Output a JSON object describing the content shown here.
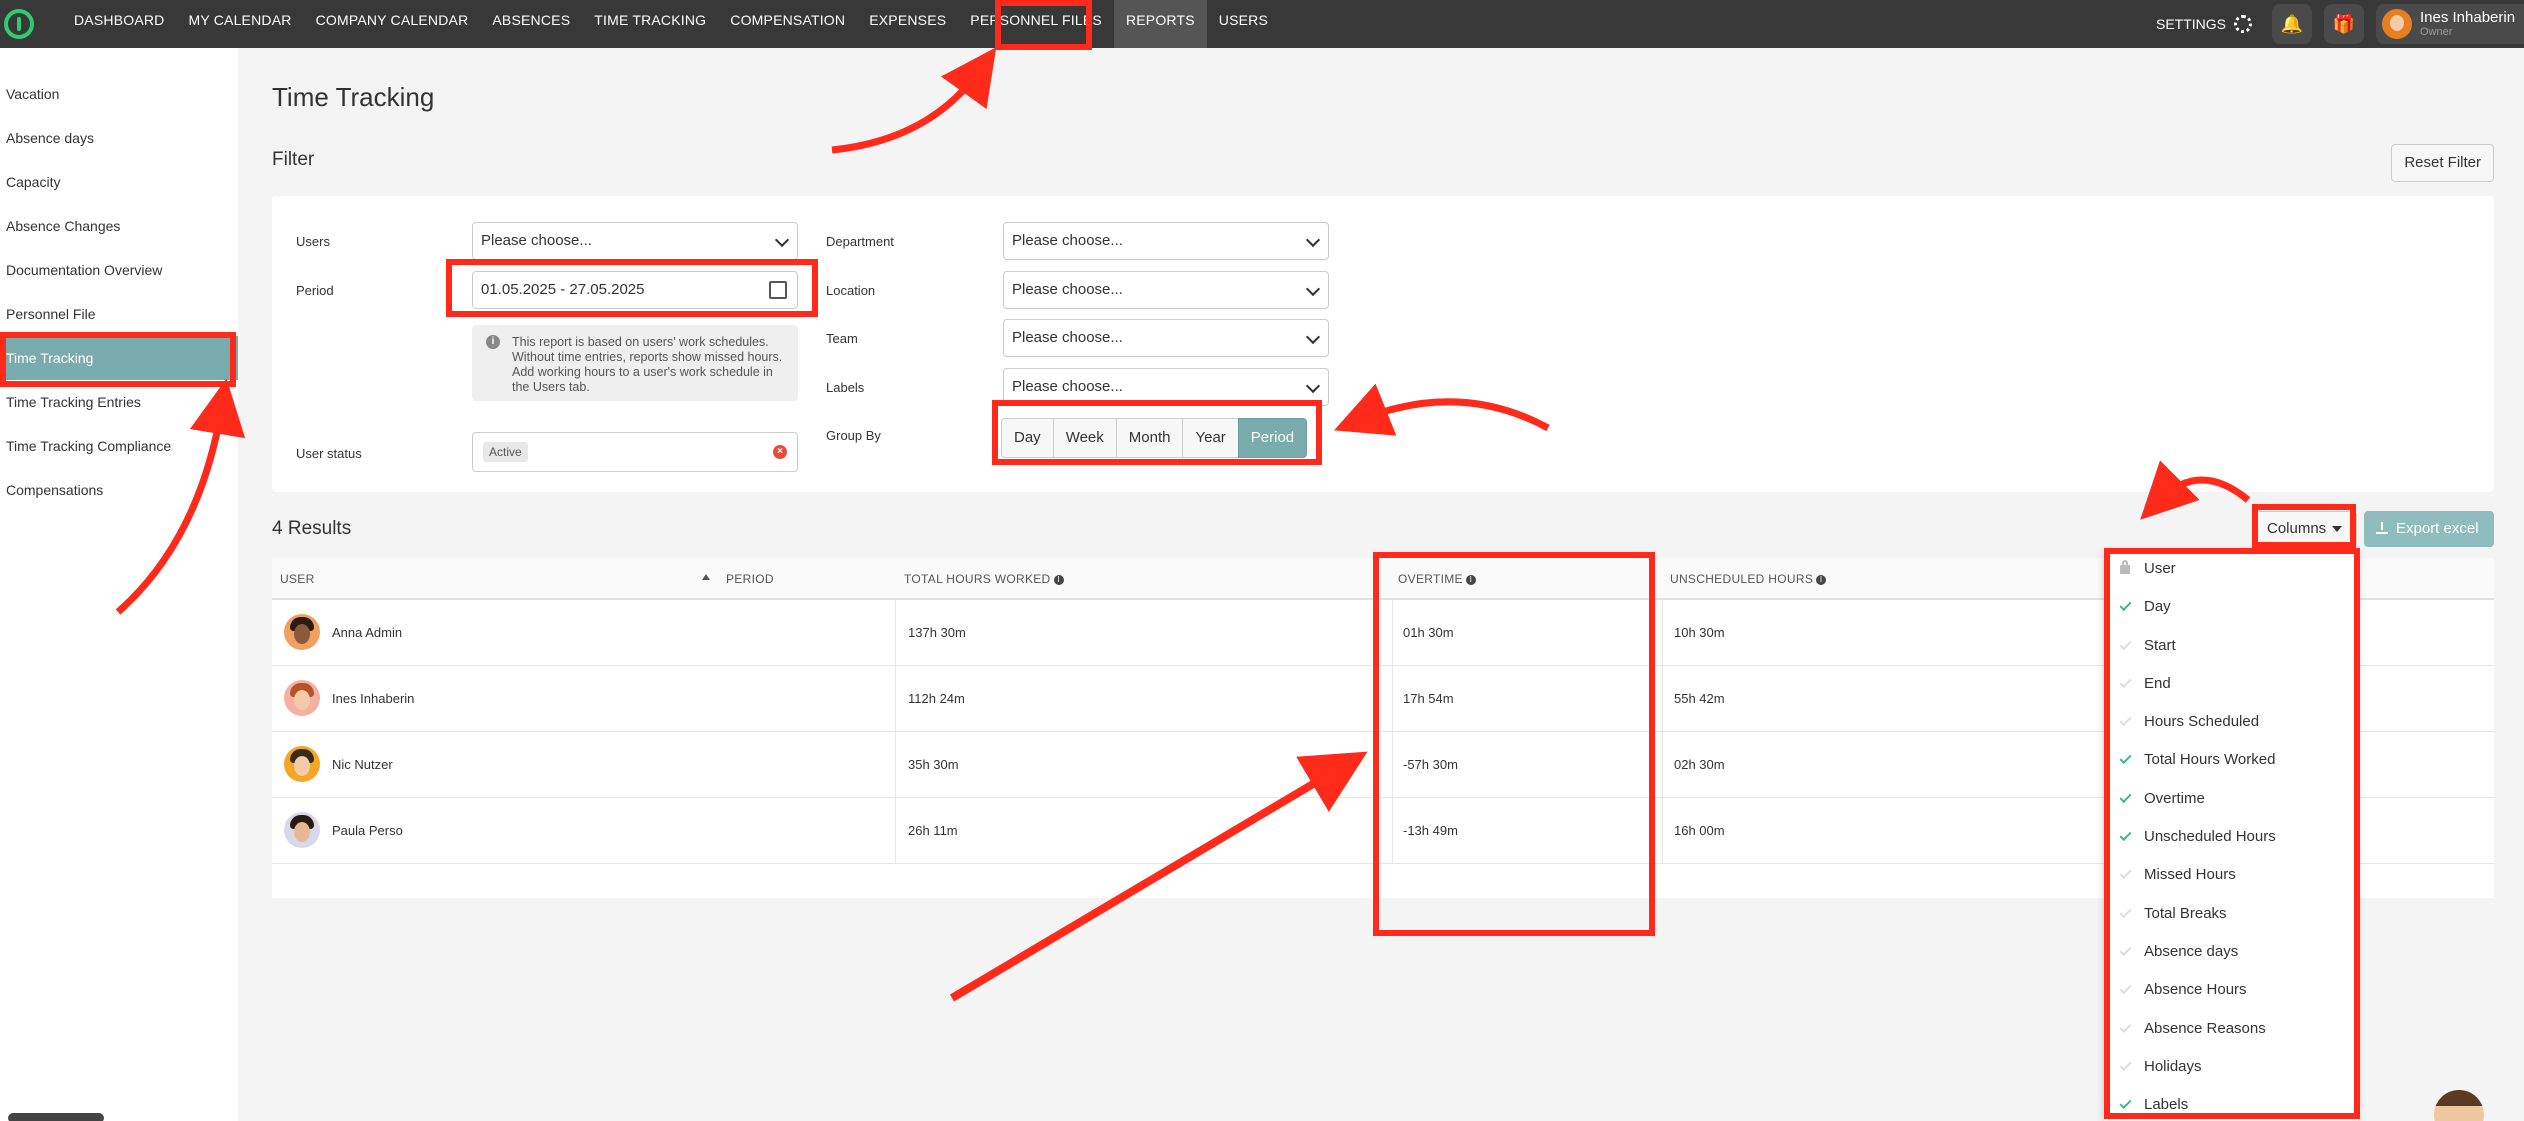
{
  "topnav": {
    "items": [
      "DASHBOARD",
      "MY CALENDAR",
      "COMPANY CALENDAR",
      "ABSENCES",
      "TIME TRACKING",
      "COMPENSATION",
      "EXPENSES",
      "PERSONNEL FILES",
      "REPORTS",
      "USERS"
    ],
    "active": "REPORTS",
    "settings_label": "SETTINGS",
    "user_name": "Ines Inhaberin",
    "user_role": "Owner"
  },
  "sidebar": {
    "items": [
      "Vacation",
      "Absence days",
      "Capacity",
      "Absence Changes",
      "Documentation Overview",
      "Personnel File",
      "Time Tracking",
      "Time Tracking Entries",
      "Time Tracking Compliance",
      "Compensations"
    ],
    "active": "Time Tracking"
  },
  "page": {
    "title": "Time Tracking",
    "filter_heading": "Filter",
    "reset_label": "Reset Filter"
  },
  "filters": {
    "users_label": "Users",
    "users_placeholder": "Please choose...",
    "period_label": "Period",
    "period_value": "01.05.2025 - 27.05.2025",
    "info_text": "This report is based on users' work schedules. Without time entries, reports show missed hours. Add working hours to a user's work schedule in the Users tab.",
    "user_status_label": "User status",
    "user_status_value": "Active",
    "department_label": "Department",
    "department_placeholder": "Please choose...",
    "location_label": "Location",
    "location_placeholder": "Please choose...",
    "team_label": "Team",
    "team_placeholder": "Please choose...",
    "labels_label": "Labels",
    "labels_placeholder": "Please choose...",
    "groupby_label": "Group By",
    "groupby_options": [
      "Day",
      "Week",
      "Month",
      "Year",
      "Period"
    ],
    "groupby_selected": "Period"
  },
  "results": {
    "count_label": "4 Results",
    "columns_button": "Columns",
    "export_button": "Export excel"
  },
  "table": {
    "headers": {
      "user": "USER",
      "period": "PERIOD",
      "total": "TOTAL HOURS WORKED",
      "overtime": "OVERTIME",
      "unscheduled": "UNSCHEDULED HOURS"
    },
    "rows": [
      {
        "user": "Anna Admin",
        "total": "137h 30m",
        "overtime": "01h 30m",
        "unscheduled": "10h 30m"
      },
      {
        "user": "Ines Inhaberin",
        "total": "112h 24m",
        "overtime": "17h 54m",
        "unscheduled": "55h 42m"
      },
      {
        "user": "Nic Nutzer",
        "total": "35h 30m",
        "overtime": "-57h 30m",
        "unscheduled": "02h 30m"
      },
      {
        "user": "Paula Perso",
        "total": "26h 11m",
        "overtime": "-13h 49m",
        "unscheduled": "16h 00m"
      }
    ]
  },
  "columns_menu": [
    {
      "label": "User",
      "state": "locked"
    },
    {
      "label": "Day",
      "state": "checked"
    },
    {
      "label": "Start",
      "state": "unchecked"
    },
    {
      "label": "End",
      "state": "unchecked"
    },
    {
      "label": "Hours Scheduled",
      "state": "unchecked"
    },
    {
      "label": "Total Hours Worked",
      "state": "checked"
    },
    {
      "label": "Overtime",
      "state": "checked"
    },
    {
      "label": "Unscheduled Hours",
      "state": "checked"
    },
    {
      "label": "Missed Hours",
      "state": "unchecked"
    },
    {
      "label": "Total Breaks",
      "state": "unchecked"
    },
    {
      "label": "Absence days",
      "state": "unchecked"
    },
    {
      "label": "Absence Hours",
      "state": "unchecked"
    },
    {
      "label": "Absence Reasons",
      "state": "unchecked"
    },
    {
      "label": "Holidays",
      "state": "unchecked"
    },
    {
      "label": "Labels",
      "state": "checked"
    }
  ],
  "colors": {
    "accent": "#7aacae",
    "annotation": "#ff2a1a",
    "check": "#3ab795"
  }
}
